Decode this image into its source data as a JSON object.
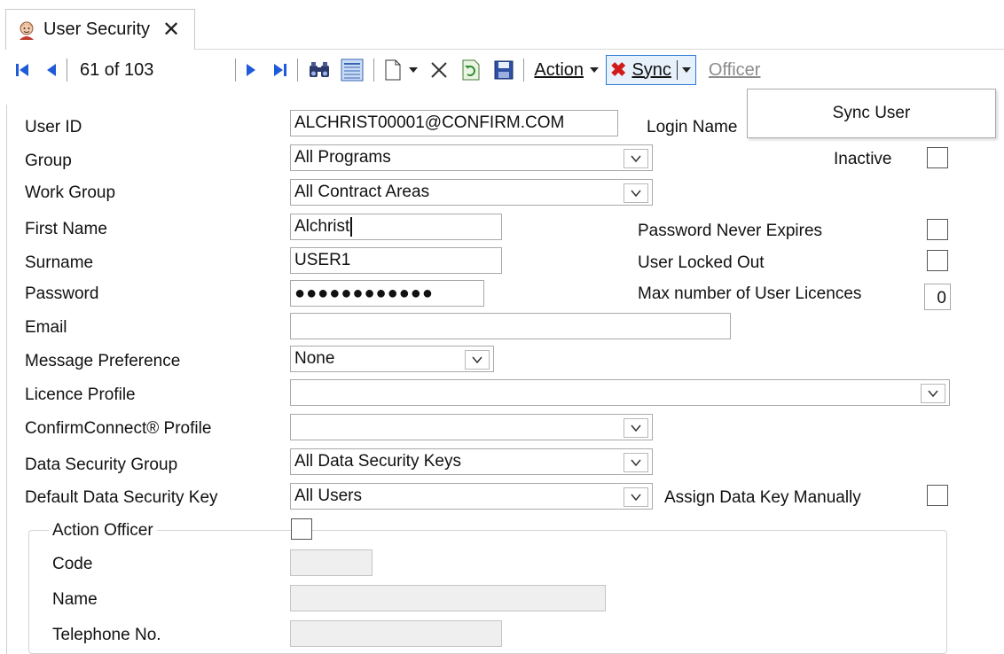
{
  "tab": {
    "title": "User Security",
    "icon": "user-icon"
  },
  "toolbar": {
    "record_position": "61 of 103",
    "action_label": "Action",
    "sync_label": "Sync",
    "officer_label": "Officer"
  },
  "sync_menu": {
    "items": [
      "Sync User"
    ]
  },
  "form": {
    "user_id": {
      "label": "User ID",
      "value": "ALCHRIST00001@CONFIRM.COM"
    },
    "login_name": {
      "label": "Login Name"
    },
    "group": {
      "label": "Group",
      "value": "All Programs"
    },
    "inactive": {
      "label": "Inactive",
      "checked": false
    },
    "work_group": {
      "label": "Work Group",
      "value": "All Contract Areas"
    },
    "first_name": {
      "label": "First Name",
      "value": "Alchrist"
    },
    "password_never_expires": {
      "label": "Password Never Expires",
      "checked": false
    },
    "surname": {
      "label": "Surname",
      "value": "USER1"
    },
    "user_locked_out": {
      "label": "User Locked Out",
      "checked": false
    },
    "password": {
      "label": "Password",
      "value": "●●●●●●●●●●●●"
    },
    "max_licences": {
      "label": "Max number of User Licences",
      "value": "0"
    },
    "email": {
      "label": "Email",
      "value": ""
    },
    "message_preference": {
      "label": "Message Preference",
      "value": "None"
    },
    "licence_profile": {
      "label": "Licence Profile",
      "value": ""
    },
    "confirmconnect_profile": {
      "label": "ConfirmConnect® Profile",
      "value": ""
    },
    "data_security_group": {
      "label": "Data Security Group",
      "value": "All Data Security Keys"
    },
    "default_data_security_key": {
      "label": "Default Data Security Key",
      "value": "All Users"
    },
    "assign_data_key_manually": {
      "label": "Assign Data Key Manually",
      "checked": false
    },
    "action_officer": {
      "label": "Action Officer",
      "checked": false,
      "code_label": "Code",
      "name_label": "Name",
      "telephone_label": "Telephone No."
    }
  }
}
